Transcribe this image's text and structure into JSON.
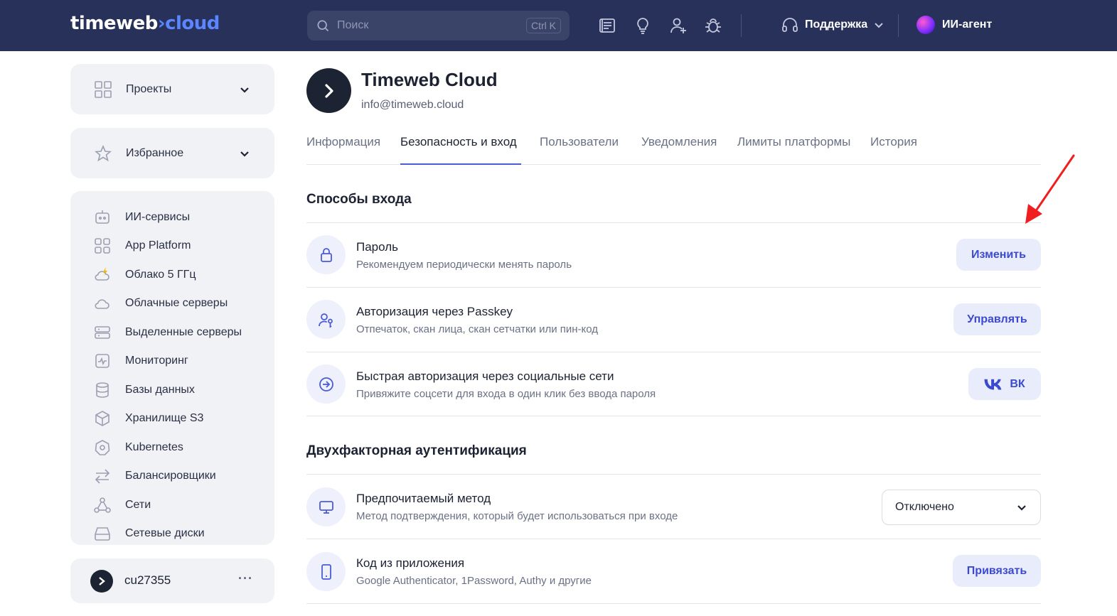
{
  "header": {
    "logo_left": "timeweb",
    "logo_right": "cloud",
    "search_placeholder": "Поиск",
    "search_shortcut": "Ctrl K",
    "support_label": "Поддержка",
    "agent_label": "ИИ-агент"
  },
  "sidebar": {
    "projects_label": "Проекты",
    "favorites_label": "Избранное",
    "items": [
      {
        "label": "ИИ-сервисы",
        "icon": "robot-icon"
      },
      {
        "label": "App Platform",
        "icon": "grid-icon"
      },
      {
        "label": "Облако 5 ГГц",
        "icon": "cloud-lightning-icon"
      },
      {
        "label": "Облачные серверы",
        "icon": "cloud-icon"
      },
      {
        "label": "Выделенные серверы",
        "icon": "server-icon"
      },
      {
        "label": "Мониторинг",
        "icon": "monitoring-icon"
      },
      {
        "label": "Базы данных",
        "icon": "database-icon"
      },
      {
        "label": "Хранилище S3",
        "icon": "cube-icon"
      },
      {
        "label": "Kubernetes",
        "icon": "kubernetes-icon"
      },
      {
        "label": "Балансировщики",
        "icon": "arrows-icon"
      },
      {
        "label": "Сети",
        "icon": "network-icon"
      },
      {
        "label": "Сетевые диски",
        "icon": "disk-icon"
      }
    ],
    "account_id": "cu27355",
    "account_more": "···"
  },
  "account": {
    "name": "Timeweb Cloud",
    "email": "info@timeweb.cloud"
  },
  "tabs": [
    {
      "label": "Информация"
    },
    {
      "label": "Безопасность и вход",
      "active": true
    },
    {
      "label": "Пользователи"
    },
    {
      "label": "Уведомления"
    },
    {
      "label": "Лимиты платформы"
    },
    {
      "label": "История"
    }
  ],
  "login_methods": {
    "title": "Способы входа",
    "rows": [
      {
        "title": "Пароль",
        "subtitle": "Рекомендуем периодически менять пароль",
        "button": "Изменить"
      },
      {
        "title": "Авторизация через Passkey",
        "subtitle": "Отпечаток, скан лица, скан сетчатки или пин-код",
        "button": "Управлять"
      },
      {
        "title": "Быстрая авторизация через социальные сети",
        "subtitle": "Привяжите соцсети для входа в один клик без ввода пароля",
        "button": "ВК"
      }
    ]
  },
  "two_factor": {
    "title": "Двухфакторная аутентификация",
    "rows": [
      {
        "title": "Предпочитаемый метод",
        "subtitle": "Метод подтверждения, который будет использоваться при входе",
        "select_value": "Отключено"
      },
      {
        "title": "Код из приложения",
        "subtitle": "Google Authenticator, 1Password, Authy и другие",
        "button": "Привязать"
      }
    ]
  },
  "colors": {
    "topbar": "#27315a",
    "accent": "#3c4ad0",
    "annotation_arrow": "#f01e1e"
  }
}
